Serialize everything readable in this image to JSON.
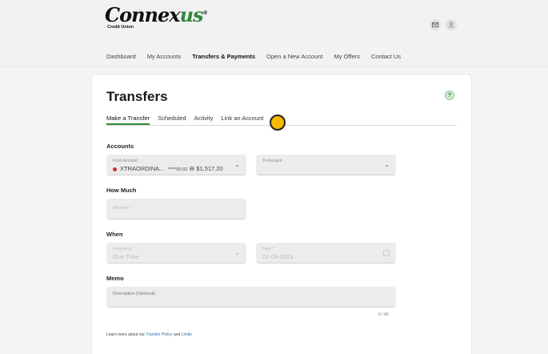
{
  "brand": {
    "name_main": "Connex",
    "name_accent": "us",
    "registered": "®",
    "subtitle": "Credit Union"
  },
  "header": {
    "mail_icon": "mail-icon",
    "user_icon": "user-icon"
  },
  "nav": {
    "items": [
      "Dashboard",
      "My Accounts",
      "Transfers & Payments",
      "Open a New Account",
      "My Offers",
      "Contact Us"
    ],
    "active": "Transfers & Payments"
  },
  "page": {
    "title": "Transfers",
    "help_glyph": "?"
  },
  "tabs": [
    "Make a Transfer",
    "Scheduled",
    "Activity",
    "Link an Account"
  ],
  "accounts": {
    "section_label": "Accounts",
    "from": {
      "label": "From Account",
      "name": "XTRAORDINA...",
      "mask": "*****00-02",
      "balance": "$1,517.20"
    },
    "to": {
      "label": "To Account"
    }
  },
  "how_much": {
    "section_label": "How Much",
    "placeholder": "Amount *"
  },
  "when": {
    "section_label": "When",
    "frequency": {
      "label": "Frequency",
      "value": "One Time"
    },
    "date": {
      "label": "Date *",
      "value": "01-09-2023"
    }
  },
  "memo": {
    "section_label": "Memo",
    "placeholder": "Description (Optional)",
    "counter": "0 / 40"
  },
  "footer": {
    "prefix": "Learn more about our ",
    "policy_link": "Transfer Policy",
    "and": " and ",
    "limits_link": "Limits"
  },
  "colors": {
    "brand_green": "#2e8a3b",
    "cursor_dot": "#f6b800",
    "account_dot": "#d62828"
  }
}
